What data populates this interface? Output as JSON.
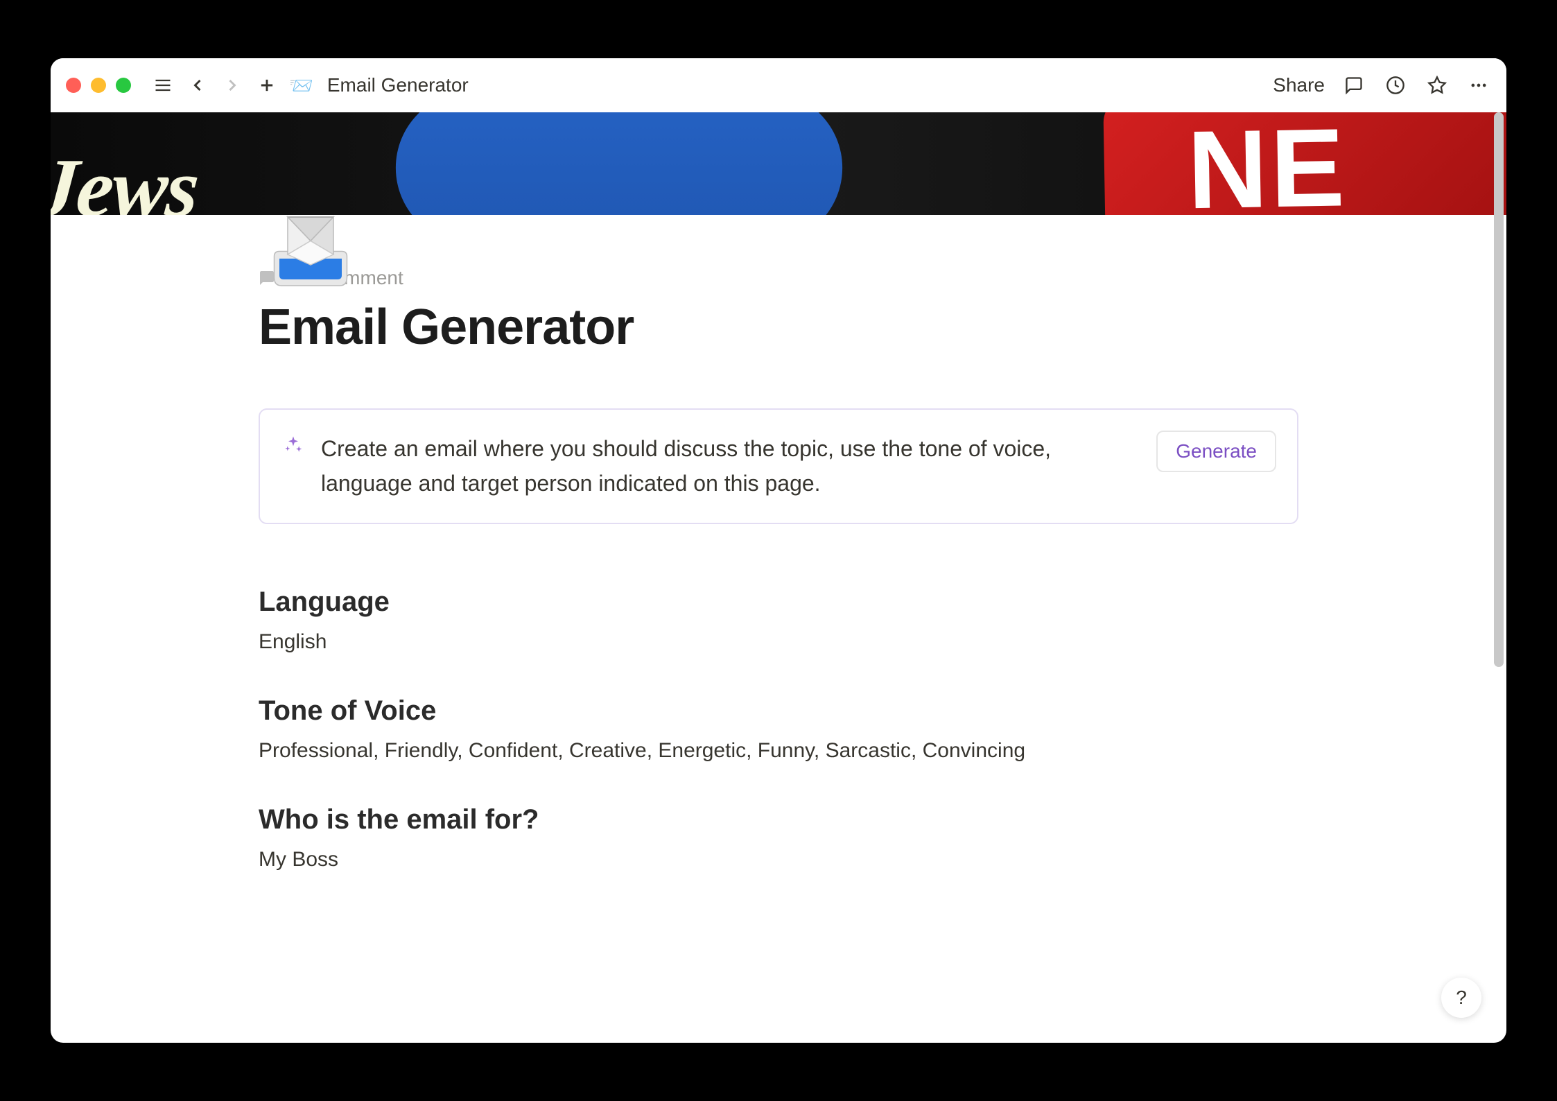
{
  "titlebar": {
    "page_title": "Email Generator",
    "share_label": "Share"
  },
  "page": {
    "add_comment_label": "Add comment",
    "title": "Email Generator",
    "ai_prompt": "Create an email where you should discuss the topic, use the tone of voice, language and target person indicated on this page.",
    "generate_label": "Generate"
  },
  "sections": {
    "language": {
      "heading": "Language",
      "value": "English"
    },
    "tone": {
      "heading": "Tone of Voice",
      "value": "Professional, Friendly, Confident, Creative, Energetic, Funny, Sarcastic, Convincing"
    },
    "recipient": {
      "heading": "Who is the email for?",
      "value": "My Boss"
    }
  },
  "help": {
    "label": "?"
  },
  "cover": {
    "left_text": "Jews",
    "right_text": "NE"
  }
}
